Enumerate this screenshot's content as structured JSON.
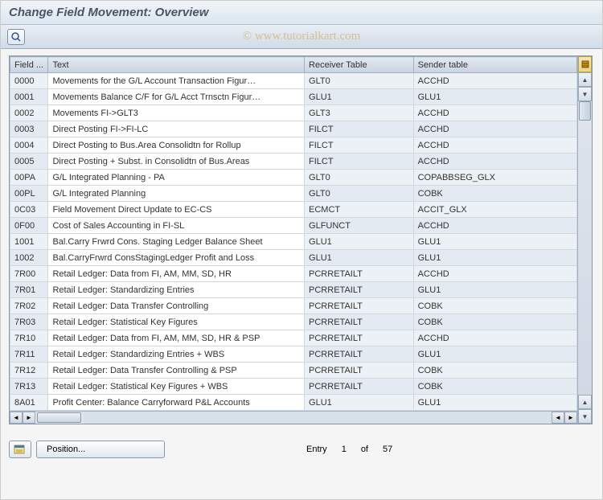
{
  "title": "Change Field Movement: Overview",
  "watermark": "© www.tutorialkart.com",
  "columns": {
    "field": "Field ...",
    "text": "Text",
    "receiver": "Receiver Table",
    "sender": "Sender table"
  },
  "rows": [
    {
      "field": "0000",
      "text": "Movements for the G/L Account Transaction Figur…",
      "receiver": "GLT0",
      "sender": "ACCHD"
    },
    {
      "field": "0001",
      "text": "Movements Balance C/F for G/L Acct Trnsctn Figur…",
      "receiver": "GLU1",
      "sender": "GLU1"
    },
    {
      "field": "0002",
      "text": "Movements FI->GLT3",
      "receiver": "GLT3",
      "sender": "ACCHD"
    },
    {
      "field": "0003",
      "text": "Direct Posting FI->FI-LC",
      "receiver": "FILCT",
      "sender": "ACCHD"
    },
    {
      "field": "0004",
      "text": "Direct Posting to Bus.Area Consolidtn for Rollup",
      "receiver": "FILCT",
      "sender": "ACCHD"
    },
    {
      "field": "0005",
      "text": "Direct Posting + Subst. in Consolidtn of Bus.Areas",
      "receiver": "FILCT",
      "sender": "ACCHD"
    },
    {
      "field": "00PA",
      "text": "G/L Integrated Planning - PA",
      "receiver": "GLT0",
      "sender": "COPABBSEG_GLX"
    },
    {
      "field": "00PL",
      "text": "G/L Integrated Planning",
      "receiver": "GLT0",
      "sender": "COBK"
    },
    {
      "field": "0C03",
      "text": "Field Movement Direct Update to EC-CS",
      "receiver": "ECMCT",
      "sender": "ACCIT_GLX"
    },
    {
      "field": "0F00",
      "text": "Cost of Sales Accounting in FI-SL",
      "receiver": "GLFUNCT",
      "sender": "ACCHD"
    },
    {
      "field": "1001",
      "text": "Bal.Carry Frwrd Cons. Staging Ledger Balance Sheet",
      "receiver": "GLU1",
      "sender": "GLU1"
    },
    {
      "field": "1002",
      "text": "Bal.CarryFrwrd ConsStagingLedger Profit and Loss",
      "receiver": "GLU1",
      "sender": "GLU1"
    },
    {
      "field": "7R00",
      "text": "Retail Ledger: Data from FI, AM, MM, SD, HR",
      "receiver": "PCRRETAILT",
      "sender": "ACCHD"
    },
    {
      "field": "7R01",
      "text": "Retail Ledger: Standardizing Entries",
      "receiver": "PCRRETAILT",
      "sender": "GLU1"
    },
    {
      "field": "7R02",
      "text": "Retail Ledger: Data Transfer Controlling",
      "receiver": "PCRRETAILT",
      "sender": "COBK"
    },
    {
      "field": "7R03",
      "text": "Retail Ledger: Statistical Key Figures",
      "receiver": "PCRRETAILT",
      "sender": "COBK"
    },
    {
      "field": "7R10",
      "text": "Retail Ledger: Data from FI, AM, MM, SD, HR & PSP",
      "receiver": "PCRRETAILT",
      "sender": "ACCHD"
    },
    {
      "field": "7R11",
      "text": "Retail Ledger: Standardizing Entries + WBS",
      "receiver": "PCRRETAILT",
      "sender": "GLU1"
    },
    {
      "field": "7R12",
      "text": "Retail Ledger: Data Transfer Controlling & PSP",
      "receiver": "PCRRETAILT",
      "sender": "COBK"
    },
    {
      "field": "7R13",
      "text": "Retail Ledger: Statistical Key Figures + WBS",
      "receiver": "PCRRETAILT",
      "sender": "COBK"
    },
    {
      "field": "8A01",
      "text": "Profit Center: Balance Carryforward P&L Accounts",
      "receiver": "GLU1",
      "sender": "GLU1"
    }
  ],
  "footer": {
    "position_label": "Position...",
    "entry_label": "Entry",
    "entry_current": "1",
    "entry_of": "of",
    "entry_total": "57"
  }
}
